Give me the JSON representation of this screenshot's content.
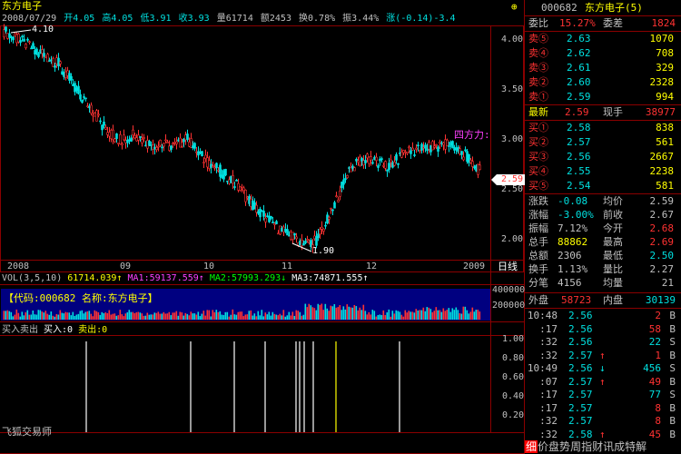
{
  "stock_name": "东方电子",
  "info_bar": {
    "date": "2008/07/29",
    "open": "开4.05",
    "high": "高4.05",
    "low": "低3.91",
    "close": "收3.93",
    "volume": "量61714",
    "amount": "额2453",
    "turnover": "换0.78%",
    "amplitude": "振3.44%",
    "change": "涨(-0.14)-3.4"
  },
  "colors": {
    "up": "#ff3232",
    "down": "#00e0e0",
    "yellow": "#ffff00",
    "ma_white": "#ffffff",
    "ma_yellow": "#ffff00",
    "ma_magenta": "#ff40ff",
    "ma_green": "#00ff00",
    "grid": "#8b0000",
    "highlight": "#000080"
  },
  "price_axis": {
    "ticks": [
      "4.00",
      "3.50",
      "3.00",
      "2.50",
      "2.00"
    ],
    "current_price": "2.59"
  },
  "annotations": {
    "high_label": "4.10",
    "low_label": "1.90",
    "magenta_text": "四方力:"
  },
  "date_axis": {
    "labels": [
      "2008",
      "09",
      "10",
      "11",
      "12",
      "2009"
    ],
    "period": "日线"
  },
  "volume_header": {
    "title": "VOL(3,5,10)",
    "vol": "61714.039",
    "ma1": "MA1:59137.559",
    "ma2": "MA2:57993.293",
    "ma3": "MA3:74871.555"
  },
  "volume_axis": {
    "ticks": [
      "400000",
      "200000"
    ]
  },
  "code_bar": "【代码:000682 名称:东方电子】",
  "indicator_header": {
    "title": "买入卖出",
    "buy": "买入:0",
    "sell": "卖出:0"
  },
  "indicator_axis": {
    "ticks": [
      "1.00",
      "0.80",
      "0.60",
      "0.40",
      "0.20"
    ]
  },
  "brand": "飞狐交易师",
  "right_panel": {
    "header_code": "000682",
    "header_name": "东方电子(5)",
    "weibi_label": "委比",
    "weibi_value": "15.27%",
    "weicha_label": "委差",
    "weicha_value": "1824",
    "sell_levels": [
      {
        "label": "卖⑤",
        "price": "2.63",
        "vol": "1070"
      },
      {
        "label": "卖④",
        "price": "2.62",
        "vol": "708"
      },
      {
        "label": "卖③",
        "price": "2.61",
        "vol": "329"
      },
      {
        "label": "卖②",
        "price": "2.60",
        "vol": "2328"
      },
      {
        "label": "卖①",
        "price": "2.59",
        "vol": "994"
      }
    ],
    "latest_label": "最新",
    "latest_price": "2.59",
    "xianshou_label": "现手",
    "xianshou_value": "38977",
    "buy_levels": [
      {
        "label": "买①",
        "price": "2.58",
        "vol": "838"
      },
      {
        "label": "买②",
        "price": "2.57",
        "vol": "561"
      },
      {
        "label": "买③",
        "price": "2.56",
        "vol": "2667"
      },
      {
        "label": "买④",
        "price": "2.55",
        "vol": "2238"
      },
      {
        "label": "买⑤",
        "price": "2.54",
        "vol": "581"
      }
    ],
    "stats": [
      {
        "l1": "涨跌",
        "v1": "-0.08",
        "c1": "#00e0e0",
        "l2": "均价",
        "v2": "2.59",
        "c2": "#c0c0c0"
      },
      {
        "l1": "涨幅",
        "v1": "-3.00%",
        "c1": "#00e0e0",
        "l2": "前收",
        "v2": "2.67",
        "c2": "#c0c0c0"
      },
      {
        "l1": "振幅",
        "v1": "7.12%",
        "c1": "#c0c0c0",
        "l2": "今开",
        "v2": "2.68",
        "c2": "#ff3232"
      },
      {
        "l1": "总手",
        "v1": "88862",
        "c1": "#ffff00",
        "l2": "最高",
        "v2": "2.69",
        "c2": "#ff3232"
      },
      {
        "l1": "总额",
        "v1": "2306",
        "c1": "#c0c0c0",
        "l2": "最低",
        "v2": "2.50",
        "c2": "#00e0e0"
      },
      {
        "l1": "换手",
        "v1": "1.13%",
        "c1": "#c0c0c0",
        "l2": "量比",
        "v2": "2.27",
        "c2": "#c0c0c0"
      },
      {
        "l1": "分笔",
        "v1": "4156",
        "c1": "#c0c0c0",
        "l2": "均量",
        "v2": "21",
        "c2": "#c0c0c0"
      }
    ],
    "outer_label": "外盘",
    "outer_value": "58723",
    "inner_label": "内盘",
    "inner_value": "30139",
    "ticks": [
      {
        "time": "10:48",
        "price": "2.56",
        "arrow": "",
        "vol": "2",
        "side": "B",
        "vcolor": "#ff3232"
      },
      {
        "time": ":17",
        "price": "2.56",
        "arrow": "",
        "vol": "58",
        "side": "B",
        "vcolor": "#ff3232"
      },
      {
        "time": ":32",
        "price": "2.56",
        "arrow": "",
        "vol": "22",
        "side": "S",
        "vcolor": "#00e0e0"
      },
      {
        "time": ":32",
        "price": "2.57",
        "arrow": "↑",
        "vol": "1",
        "side": "B",
        "vcolor": "#ff3232"
      },
      {
        "time": "10:49",
        "price": "2.56",
        "arrow": "↓",
        "vol": "456",
        "side": "S",
        "vcolor": "#00e0e0"
      },
      {
        "time": ":07",
        "price": "2.57",
        "arrow": "↑",
        "vol": "49",
        "side": "B",
        "vcolor": "#ff3232"
      },
      {
        "time": ":17",
        "price": "2.57",
        "arrow": "",
        "vol": "77",
        "side": "S",
        "vcolor": "#00e0e0"
      },
      {
        "time": ":17",
        "price": "2.57",
        "arrow": "",
        "vol": "8",
        "side": "B",
        "vcolor": "#ff3232"
      },
      {
        "time": ":32",
        "price": "2.57",
        "arrow": "",
        "vol": "8",
        "side": "B",
        "vcolor": "#ff3232"
      },
      {
        "time": ":32",
        "price": "2.58",
        "arrow": "↑",
        "vol": "45",
        "side": "B",
        "vcolor": "#ff3232"
      }
    ],
    "bottom_tabs": {
      "active": "细",
      "items": [
        "价",
        "盘",
        "势",
        "周",
        "指",
        "财",
        "讯",
        "成",
        "特",
        "解"
      ]
    }
  }
}
